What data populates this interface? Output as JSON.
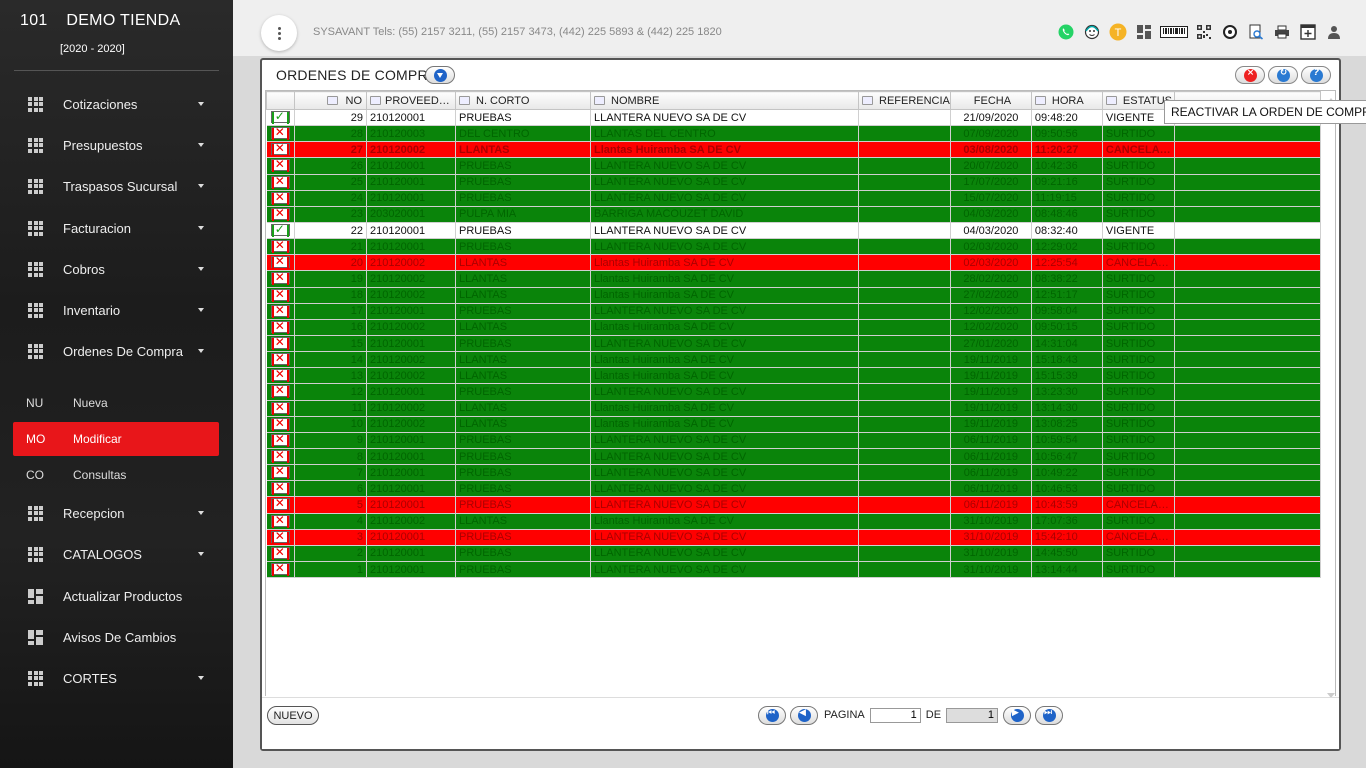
{
  "app": {
    "store_number": "101",
    "store_name": "DEMO TIENDA",
    "period": "[2020 - 2020]"
  },
  "topbar": {
    "contact": "SYSAVANT Tels: (55) 2157 3211, (55) 2157 3473, (442) 225 5893 & (442) 225 1820",
    "icons": [
      "whatsapp-icon",
      "support-agent-icon",
      "user-initial-icon",
      "dashboard-icon",
      "barcode-icon",
      "qr-code-icon",
      "disc-icon",
      "search-document-icon",
      "printer-icon",
      "add-window-icon",
      "person-icon"
    ],
    "user_initial": "T"
  },
  "sidebar": {
    "items": [
      {
        "label": "Cotizaciones"
      },
      {
        "label": "Presupuestos"
      },
      {
        "label": "Traspasos Sucursal"
      },
      {
        "label": "Facturacion"
      },
      {
        "label": "Cobros"
      },
      {
        "label": "Inventario"
      },
      {
        "label": "Ordenes De Compra"
      }
    ],
    "sub_items": [
      {
        "abbr": "NU",
        "label": "Nueva"
      },
      {
        "abbr": "MO",
        "label": "Modificar"
      },
      {
        "abbr": "CO",
        "label": "Consultas"
      }
    ],
    "items_after": [
      {
        "label": "Recepcion"
      },
      {
        "label": "CATALOGOS"
      },
      {
        "label": "Actualizar Productos"
      },
      {
        "label": "Avisos De Cambios"
      },
      {
        "label": "CORTES"
      }
    ]
  },
  "panel": {
    "title": "ORDENES DE COMPRA",
    "tooltip": "REACTIVAR LA ORDEN DE COMPRA"
  },
  "table": {
    "headers": [
      "NO",
      "PROVEED…",
      "N. CORTO",
      "NOMBRE",
      "REFERENCIA",
      "FECHA",
      "HORA",
      "ESTATUS"
    ],
    "rows": [
      {
        "check": "ok",
        "no": "29",
        "proveedor": "210120001",
        "corto": "PRUEBAS",
        "nombre": "LLANTERA NUEVO SA DE CV",
        "referencia": "",
        "fecha": "21/09/2020",
        "hora": "09:48:20",
        "estatus": "VIGENTE",
        "style": "white"
      },
      {
        "check": "x",
        "no": "28",
        "proveedor": "210120003",
        "corto": "DEL CENTRO",
        "nombre": "LLANTAS DEL CENTRO",
        "referencia": "",
        "fecha": "07/09/2020",
        "hora": "09:50:56",
        "estatus": "SURTIDO",
        "style": "green"
      },
      {
        "check": "x",
        "no": "27",
        "proveedor": "210120002",
        "corto": "LLANTAS",
        "nombre": "Llantas Huiramba SA DE CV",
        "referencia": "",
        "fecha": "03/08/2020",
        "hora": "11:20:27",
        "estatus": "CANCELA…",
        "style": "red bold"
      },
      {
        "check": "x",
        "no": "26",
        "proveedor": "210120001",
        "corto": "PRUEBAS",
        "nombre": "LLANTERA NUEVO SA DE CV",
        "referencia": "",
        "fecha": "20/07/2020",
        "hora": "10:42:36",
        "estatus": "SURTIDO",
        "style": "green"
      },
      {
        "check": "x",
        "no": "25",
        "proveedor": "210120001",
        "corto": "PRUEBAS",
        "nombre": "LLANTERA NUEVO SA DE CV",
        "referencia": "",
        "fecha": "17/07/2020",
        "hora": "09:21:16",
        "estatus": "SURTIDO",
        "style": "green"
      },
      {
        "check": "x",
        "no": "24",
        "proveedor": "210120001",
        "corto": "PRUEBAS",
        "nombre": "LLANTERA NUEVO SA DE CV",
        "referencia": "",
        "fecha": "15/07/2020",
        "hora": "11:19:15",
        "estatus": "SURTIDO",
        "style": "green"
      },
      {
        "check": "x",
        "no": "23",
        "proveedor": "203020001",
        "corto": "PULPA MIA",
        "nombre": "BARRIGA MACOUZET DAVID",
        "referencia": "",
        "fecha": "04/03/2020",
        "hora": "08:48:46",
        "estatus": "SURTIDO",
        "style": "green"
      },
      {
        "check": "ok",
        "no": "22",
        "proveedor": "210120001",
        "corto": "PRUEBAS",
        "nombre": "LLANTERA NUEVO SA DE CV",
        "referencia": "",
        "fecha": "04/03/2020",
        "hora": "08:32:40",
        "estatus": "VIGENTE",
        "style": "white"
      },
      {
        "check": "x",
        "no": "21",
        "proveedor": "210120001",
        "corto": "PRUEBAS",
        "nombre": "LLANTERA NUEVO SA DE CV",
        "referencia": "",
        "fecha": "02/03/2020",
        "hora": "12:29:02",
        "estatus": "SURTIDO",
        "style": "green"
      },
      {
        "check": "x",
        "no": "20",
        "proveedor": "210120002",
        "corto": "LLANTAS",
        "nombre": "Llantas Huiramba SA DE CV",
        "referencia": "",
        "fecha": "02/03/2020",
        "hora": "12:25:54",
        "estatus": "CANCELA…",
        "style": "red"
      },
      {
        "check": "x",
        "no": "19",
        "proveedor": "210120002",
        "corto": "LLANTAS",
        "nombre": "Llantas Huiramba SA DE CV",
        "referencia": "",
        "fecha": "28/02/2020",
        "hora": "08:38:22",
        "estatus": "SURTIDO",
        "style": "green"
      },
      {
        "check": "x",
        "no": "18",
        "proveedor": "210120002",
        "corto": "LLANTAS",
        "nombre": "Llantas Huiramba SA DE CV",
        "referencia": "",
        "fecha": "27/02/2020",
        "hora": "12:51:17",
        "estatus": "SURTIDO",
        "style": "green"
      },
      {
        "check": "x",
        "no": "17",
        "proveedor": "210120001",
        "corto": "PRUEBAS",
        "nombre": "LLANTERA NUEVO SA DE CV",
        "referencia": "",
        "fecha": "12/02/2020",
        "hora": "09:58:04",
        "estatus": "SURTIDO",
        "style": "green"
      },
      {
        "check": "x",
        "no": "16",
        "proveedor": "210120002",
        "corto": "LLANTAS",
        "nombre": "Llantas Huiramba SA DE CV",
        "referencia": "",
        "fecha": "12/02/2020",
        "hora": "09:50:15",
        "estatus": "SURTIDO",
        "style": "green"
      },
      {
        "check": "x",
        "no": "15",
        "proveedor": "210120001",
        "corto": "PRUEBAS",
        "nombre": "LLANTERA NUEVO SA DE CV",
        "referencia": "",
        "fecha": "27/01/2020",
        "hora": "14:31:04",
        "estatus": "SURTIDO",
        "style": "green"
      },
      {
        "check": "x",
        "no": "14",
        "proveedor": "210120002",
        "corto": "LLANTAS",
        "nombre": "Llantas Huiramba SA DE CV",
        "referencia": "",
        "fecha": "19/11/2019",
        "hora": "15:18:43",
        "estatus": "SURTIDO",
        "style": "green"
      },
      {
        "check": "x",
        "no": "13",
        "proveedor": "210120002",
        "corto": "LLANTAS",
        "nombre": "Llantas Huiramba SA DE CV",
        "referencia": "",
        "fecha": "19/11/2019",
        "hora": "15:15:39",
        "estatus": "SURTIDO",
        "style": "green"
      },
      {
        "check": "x",
        "no": "12",
        "proveedor": "210120001",
        "corto": "PRUEBAS",
        "nombre": "LLANTERA NUEVO SA DE CV",
        "referencia": "",
        "fecha": "19/11/2019",
        "hora": "13:23:30",
        "estatus": "SURTIDO",
        "style": "green"
      },
      {
        "check": "x",
        "no": "11",
        "proveedor": "210120002",
        "corto": "LLANTAS",
        "nombre": "Llantas Huiramba SA DE CV",
        "referencia": "",
        "fecha": "19/11/2019",
        "hora": "13:14:30",
        "estatus": "SURTIDO",
        "style": "green"
      },
      {
        "check": "x",
        "no": "10",
        "proveedor": "210120002",
        "corto": "LLANTAS",
        "nombre": "Llantas Huiramba SA DE CV",
        "referencia": "",
        "fecha": "19/11/2019",
        "hora": "13:08:25",
        "estatus": "SURTIDO",
        "style": "green"
      },
      {
        "check": "x",
        "no": "9",
        "proveedor": "210120001",
        "corto": "PRUEBAS",
        "nombre": "LLANTERA NUEVO SA DE CV",
        "referencia": "",
        "fecha": "06/11/2019",
        "hora": "10:59:54",
        "estatus": "SURTIDO",
        "style": "green"
      },
      {
        "check": "x",
        "no": "8",
        "proveedor": "210120001",
        "corto": "PRUEBAS",
        "nombre": "LLANTERA NUEVO SA DE CV",
        "referencia": "",
        "fecha": "06/11/2019",
        "hora": "10:56:47",
        "estatus": "SURTIDO",
        "style": "green"
      },
      {
        "check": "x",
        "no": "7",
        "proveedor": "210120001",
        "corto": "PRUEBAS",
        "nombre": "LLANTERA NUEVO SA DE CV",
        "referencia": "",
        "fecha": "06/11/2019",
        "hora": "10:49:22",
        "estatus": "SURTIDO",
        "style": "green"
      },
      {
        "check": "x",
        "no": "6",
        "proveedor": "210120001",
        "corto": "PRUEBAS",
        "nombre": "LLANTERA NUEVO SA DE CV",
        "referencia": "",
        "fecha": "06/11/2019",
        "hora": "10:46:53",
        "estatus": "SURTIDO",
        "style": "green"
      },
      {
        "check": "x",
        "no": "5",
        "proveedor": "210120001",
        "corto": "PRUEBAS",
        "nombre": "LLANTERA NUEVO SA DE CV",
        "referencia": "",
        "fecha": "06/11/2019",
        "hora": "10:43:59",
        "estatus": "CANCELA…",
        "style": "red"
      },
      {
        "check": "x",
        "no": "4",
        "proveedor": "210120002",
        "corto": "LLANTAS",
        "nombre": "Llantas Huiramba SA DE CV",
        "referencia": "",
        "fecha": "31/10/2019",
        "hora": "17:07:36",
        "estatus": "SURTIDO",
        "style": "green"
      },
      {
        "check": "x",
        "no": "3",
        "proveedor": "210120001",
        "corto": "PRUEBAS",
        "nombre": "LLANTERA NUEVO SA DE CV",
        "referencia": "",
        "fecha": "31/10/2019",
        "hora": "15:42:10",
        "estatus": "CANCELA…",
        "style": "red"
      },
      {
        "check": "x",
        "no": "2",
        "proveedor": "210120001",
        "corto": "PRUEBAS",
        "nombre": "LLANTERA NUEVO SA DE CV",
        "referencia": "",
        "fecha": "31/10/2019",
        "hora": "14:45:50",
        "estatus": "SURTIDO",
        "style": "green"
      },
      {
        "check": "x",
        "no": "1",
        "proveedor": "210120001",
        "corto": "PRUEBAS",
        "nombre": "LLANTERA NUEVO SA DE CV",
        "referencia": "",
        "fecha": "31/10/2019",
        "hora": "13:14:44",
        "estatus": "SURTIDO",
        "style": "green"
      }
    ]
  },
  "footer": {
    "new_button": "NUEVO",
    "page_label": "PAGINA",
    "page_value": "1",
    "of_label": "DE",
    "total_pages": "1"
  },
  "colors": {
    "accent_red": "#e8161a",
    "row_green": "#0a840a",
    "row_red": "#ff0000",
    "link_blue": "#1e63c8"
  }
}
